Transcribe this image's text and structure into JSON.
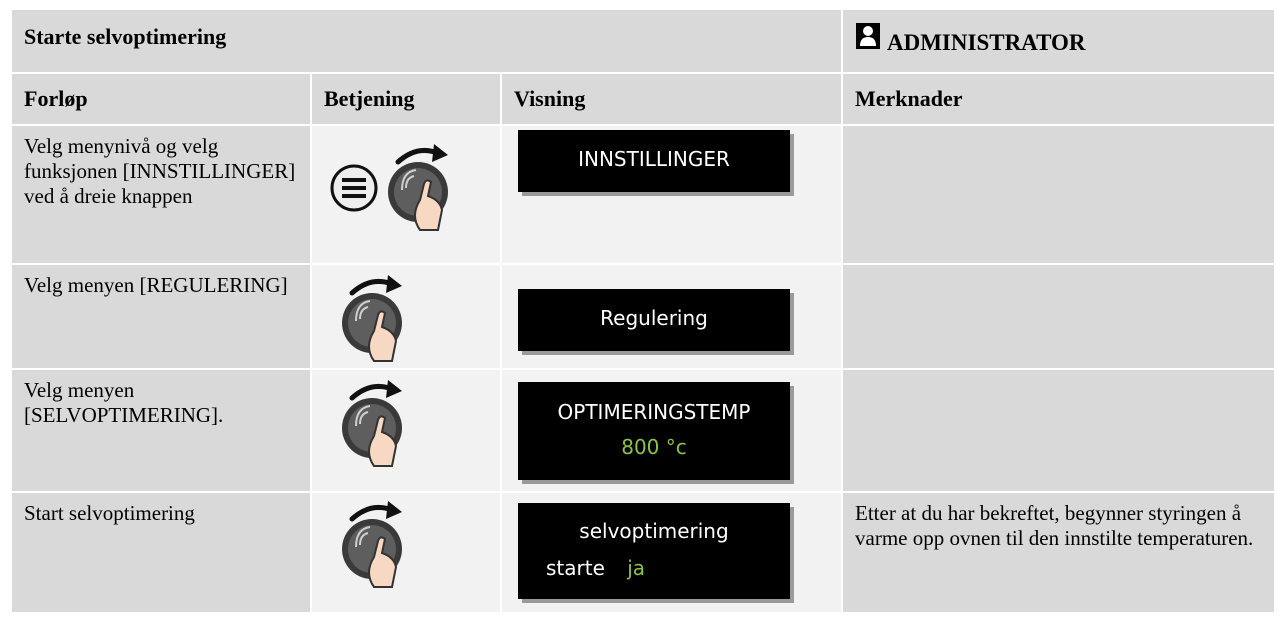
{
  "title": "Starte selvoptimering",
  "role": "ADMINISTRATOR",
  "headers": {
    "col1": "Forløp",
    "col2": "Betjening",
    "col3": "Visning",
    "col4": "Merknader"
  },
  "rows": [
    {
      "step": "Velg menynivå og velg funksjonen [INNSTILLINGER] ved å dreie knappen",
      "controls": [
        "menu-button-icon",
        "rotate-knob-icon"
      ],
      "display_line1": "INNSTILLINGER",
      "note": ""
    },
    {
      "step": "Velg menyen [REGULERING]",
      "controls": [
        "rotate-knob-icon"
      ],
      "display_line1": "Regulering",
      "note": ""
    },
    {
      "step": "Velg menyen [SELVOPTIMERING].",
      "controls": [
        "rotate-knob-icon"
      ],
      "display_line1": "OPTIMERINGSTEMP",
      "display_value": "800 °c",
      "note": ""
    },
    {
      "step": "Start selvoptimering",
      "controls": [
        "rotate-knob-icon"
      ],
      "display_line1": "selvoptimering",
      "display_label": "starte",
      "display_value": "ja",
      "note": "Etter at du har bekreftet, begynner styringen å varme opp ovnen til den innstilte temperaturen."
    }
  ],
  "colors": {
    "header_bg": "#d9d9d9",
    "cell_light_bg": "#f2f2f2",
    "display_bg": "#000000",
    "display_value_color": "#8bc34a"
  }
}
